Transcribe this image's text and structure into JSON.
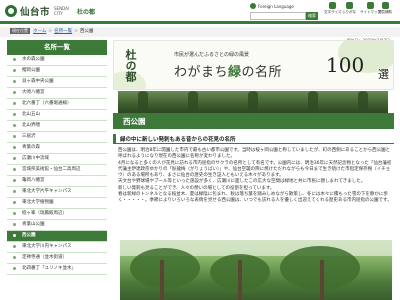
{
  "header": {
    "logo_text": "仙台市",
    "logo_sub": "SENDAI CITY",
    "logo_sub2": "杜の都",
    "language_label": "Foreign Language",
    "search_placeholder": "",
    "search_button": "検索",
    "utilities": [
      {
        "label": "文字サイズ",
        "icon": "text-size-icon"
      },
      {
        "label": "ふりがな",
        "icon": "furigana-icon"
      },
      {
        "label": "サイトマップ",
        "icon": "sitemap-icon"
      },
      {
        "label": "閲覧補助",
        "icon": "accessibility-icon"
      }
    ]
  },
  "breadcrumb": {
    "home_label": "現在位置",
    "items": [
      "ホーム",
      "名所一覧",
      "西公園"
    ]
  },
  "update_date": "更新日：2020年2月7日",
  "sidebar": {
    "title": "名所一覧",
    "items": [
      {
        "label": "水の森公園"
      },
      {
        "label": "榴岡公園"
      },
      {
        "label": "貝ヶ森中央公園"
      },
      {
        "label": "大崎八幡宮"
      },
      {
        "label": "北六番丁（六番堀通線）"
      },
      {
        "label": "北山五山"
      },
      {
        "label": "北山界隈"
      },
      {
        "label": "三居沢"
      },
      {
        "label": "青葉の森"
      },
      {
        "label": "広瀬川中流域"
      },
      {
        "label": "宮城県美術館・仙台二高周辺"
      },
      {
        "label": "亀岡八幡宮"
      },
      {
        "label": "東北大学片平キャンパス"
      },
      {
        "label": "東北大学植物園"
      },
      {
        "label": "経ヶ峯（瑞鳳殿周辺）"
      },
      {
        "label": "青葉山公園"
      },
      {
        "label": "西公園"
      },
      {
        "label": "東北大学川内キャンパス"
      },
      {
        "label": "定禅寺通（並木街道）"
      },
      {
        "label": "北四番丁「ユリノキ並木」"
      }
    ],
    "active_index": 16
  },
  "banner": {
    "calligraphy": "杜の都",
    "small_text": "市民が選んだふるさとの緑の風景",
    "title_pre": "わがまち",
    "title_green": "緑",
    "title_post": "の名所",
    "number": "100",
    "sen": "選"
  },
  "content": {
    "park_title": "西公園",
    "subheading": "緑の中に新しい発刺もある昔からの花見の名所",
    "paragraphs": [
      "西公園は、明治8年に開園した市内で最も古い都市公園です。当時は桜ヶ岡公園と称していましたが、町の西側にあることから西公園と呼ばれるようになり現在の西公園に名称が変わりました。",
      "4月になると多くの人が花見に訪れる市内屈指のサクラの名所として有名です。公園内には、明治36年に天然記念物となった「仙台藩初代藩主伊達政宗ゆかりの「臥龍梅（がりょうばい）」や、仙台空襲の際に焼けただれながらも今日まで生き続けた市指定保存樹（イチョウ）のある場所もあり、まさに仙台の歴史の生き証人ともいえる木々があります。",
      "天文台や野球場やプール等といった施設が多く、広瀬川に面したこの広大な空間は緑地と共に市民に親しまれてきました。",
      "新しい発刺も見ることができ、人々の憩いの場としての役割を担っています。",
      "春は新緑のトンネルとなる桜並木、夏は緑陰に包まれ、秋は落ち葉を踏みしめながら散策し、冬には木々に積もった雪の下を静かに歩く・・・・・。季節によりいろいろな表情を見せる西公園は、いつでも訪れる人を優しく出迎えてくれる歴史ある市内屈指の公園です。"
    ]
  },
  "colors": {
    "primary_green": "#3d7a3a",
    "link_blue": "#2b5fa8"
  }
}
